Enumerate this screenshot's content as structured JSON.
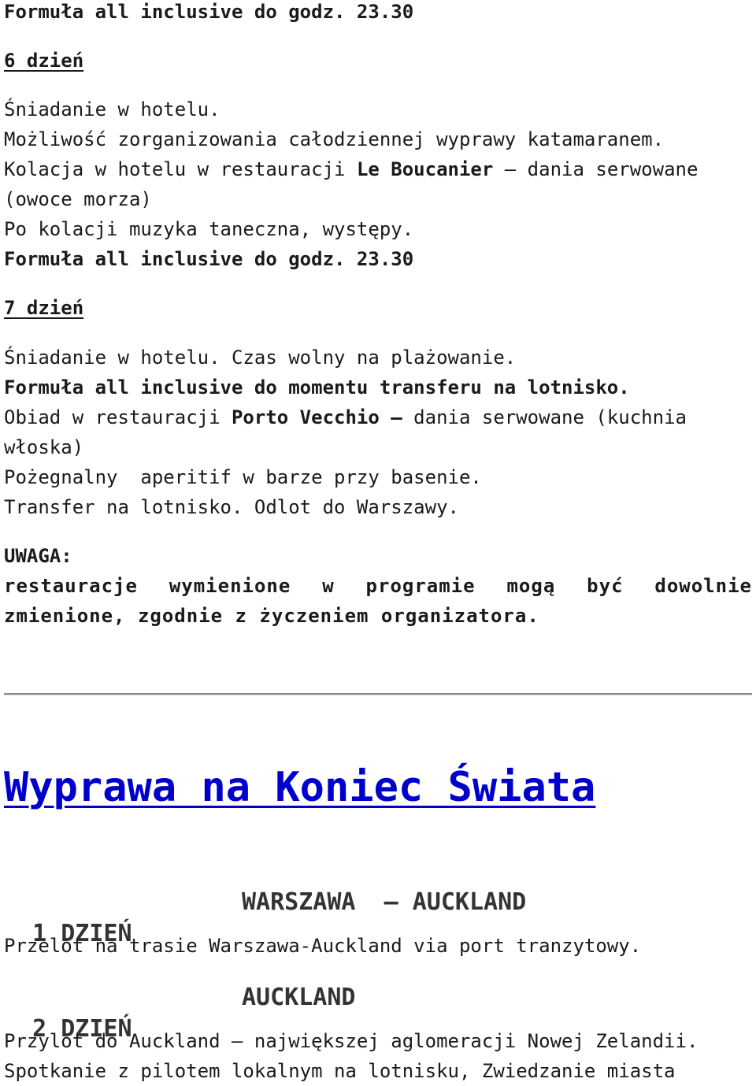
{
  "section_prev": {
    "top_formula": "Formuła all inclusive do godz. 23.30",
    "day6": {
      "heading": "6 dzień",
      "lines": [
        "Śniadanie w hotelu.",
        "Możliwość zorganizowania całodziennej wyprawy katamaranem."
      ],
      "dinner_pre": "Kolacja w hotelu w restauracji ",
      "dinner_restaurant": "Le Boucanier",
      "dinner_post": " – dania serwowane",
      "dinner_cont": "(owoce morza)",
      "after": "Po kolacji muzyka taneczna, występy.",
      "formula": "Formuła all inclusive do godz. 23.30"
    },
    "day7": {
      "heading": "7 dzień",
      "line1": "Śniadanie w hotelu. Czas wolny na plażowanie.",
      "formula": "Formuła all inclusive do momentu transferu na lotnisko.",
      "lunch_pre": "Obiad w restauracji ",
      "lunch_restaurant": "Porto Vecchio –",
      "lunch_post": " dania serwowane (kuchnia",
      "lunch_cont": "włoska)",
      "aperitif": "Pożegnalny  aperitif w barze przy basenie.",
      "transfer": "Transfer na lotnisko. Odlot do Warszawy."
    },
    "note": {
      "label": "UWAGA:",
      "line1": "restauracje wymienione w programie mogą być dowolnie",
      "line2": "zmienione, zgodnie z życzeniem organizatora."
    }
  },
  "section_next": {
    "title": "Wyprawa na Koniec Świata",
    "title_color": "#0000cc",
    "days": [
      {
        "label": "1 DZIEŃ",
        "city": "WARSZAWA  – AUCKLAND",
        "text": [
          "Przelot na trasie Warszawa-Auckland via port tranzytowy."
        ]
      },
      {
        "label": "2 DZIEŃ",
        "city": "AUCKLAND",
        "text": [
          "Przylot do Auckland – największej aglomeracji Nowej Zelandii.",
          "Spotkanie z pilotem lokalnym na lotnisku, Zwiedzanie miasta"
        ]
      }
    ]
  }
}
